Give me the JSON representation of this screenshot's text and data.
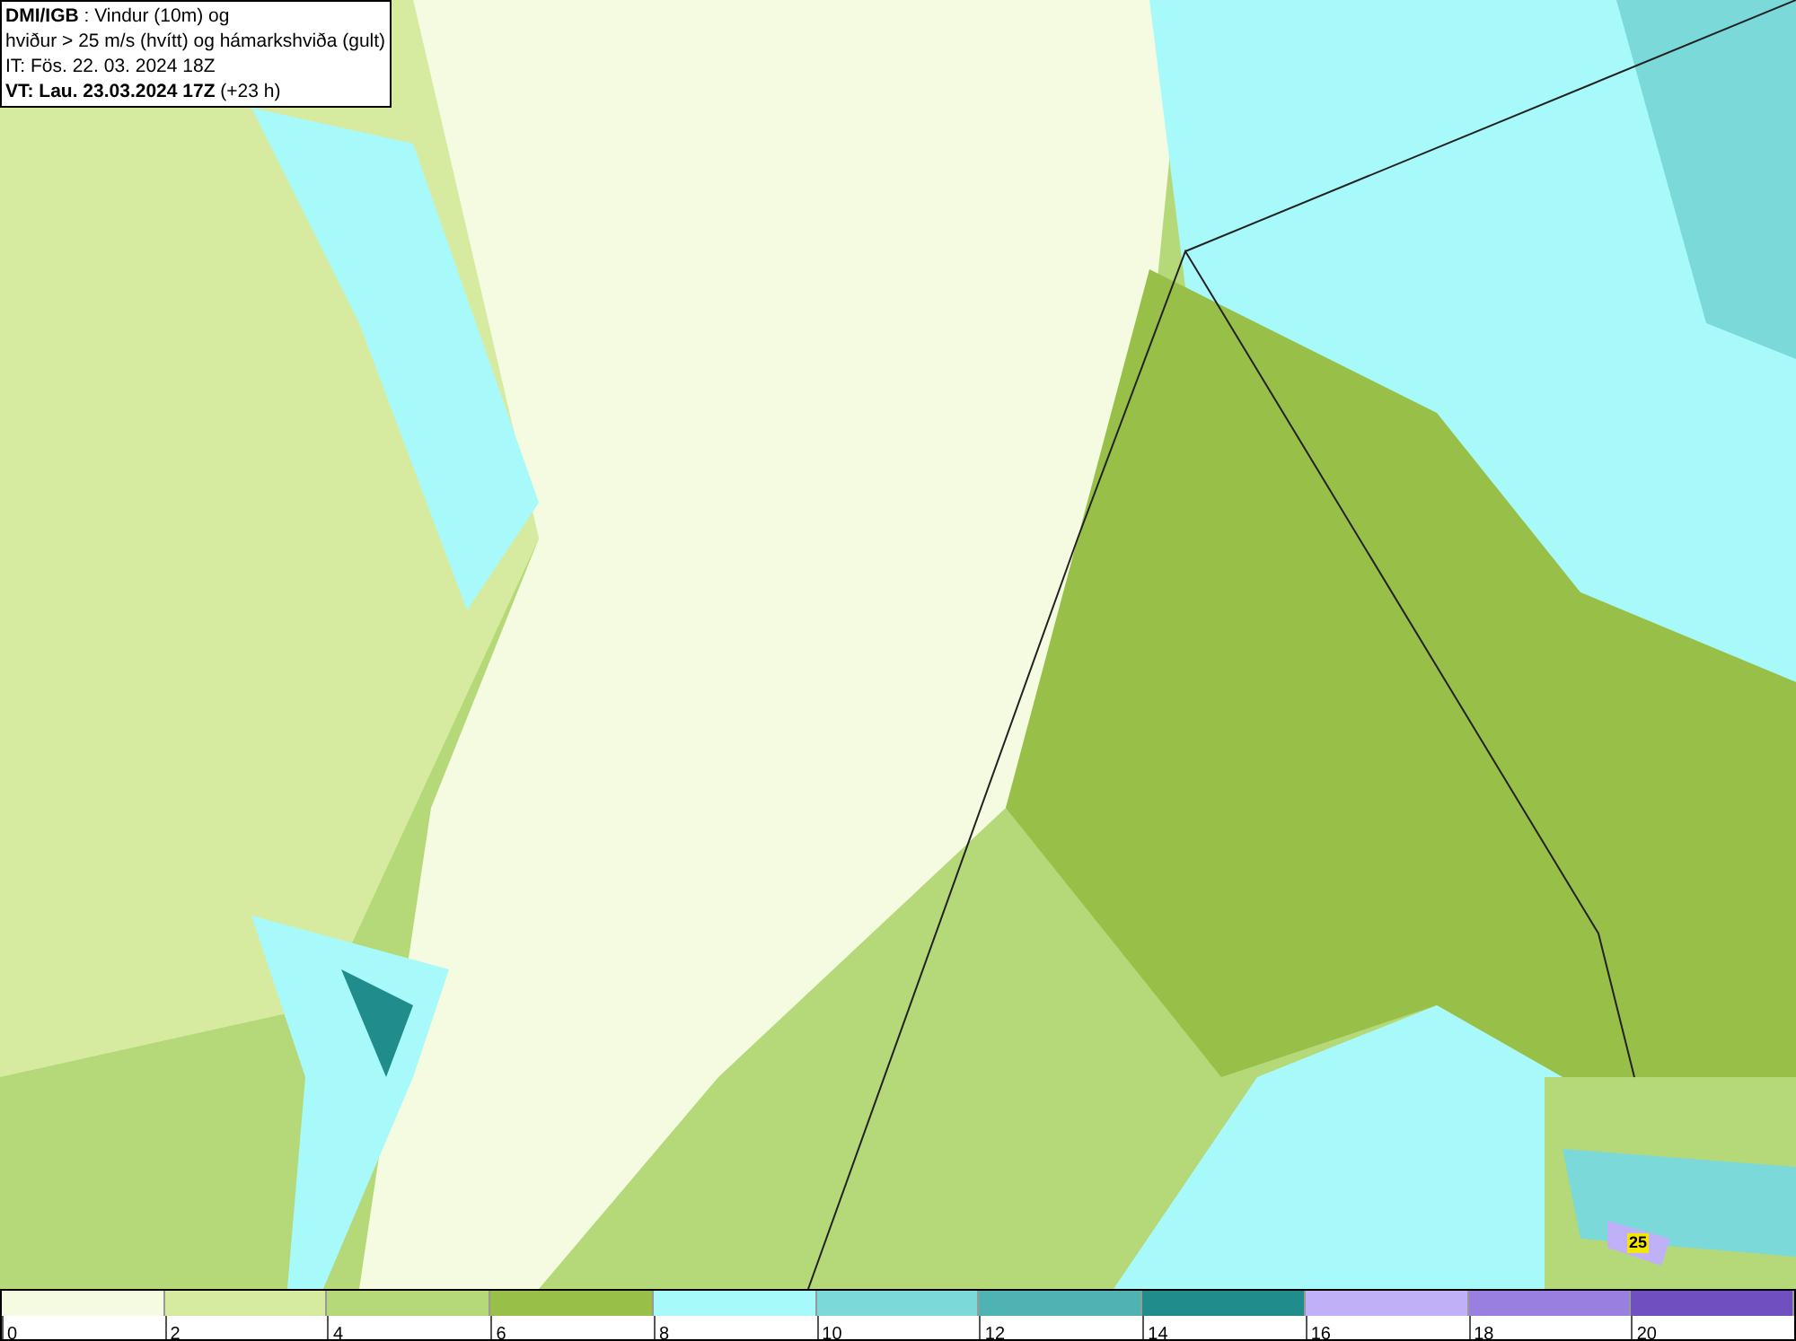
{
  "header": {
    "lines": [
      "**DMI/IGB** : Vindur (10m) og",
      "hviður > 25 m/s (hvítt) og hámarkshviða (gult)",
      "IT: Fös. 22. 03. 2024 18Z",
      "**VT: Lau. 23.03.2024 17Z** (+23 h)"
    ]
  },
  "map": {
    "gust_label": "25"
  },
  "legend": {
    "bins": [
      {
        "color": "#f5fbe0",
        "tick": "0"
      },
      {
        "color": "#d6eba0",
        "tick": "2"
      },
      {
        "color": "#b5d978",
        "tick": "4"
      },
      {
        "color": "#98bf48",
        "tick": "6"
      },
      {
        "color": "#a8fafa",
        "tick": "8"
      },
      {
        "color": "#7cd9d9",
        "tick": "10"
      },
      {
        "color": "#4fb3b3",
        "tick": "12"
      },
      {
        "color": "#208c8c",
        "tick": "14"
      },
      {
        "color": "#c0b0f8",
        "tick": "16"
      },
      {
        "color": "#9980e0",
        "tick": "18"
      },
      {
        "color": "#7050c0",
        "tick": "20"
      }
    ]
  }
}
